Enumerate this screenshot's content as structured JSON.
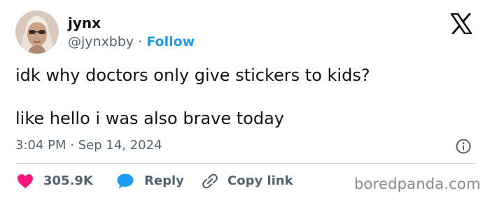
{
  "user": {
    "display_name": "jynx",
    "handle": "@jynxbby",
    "separator": "·",
    "follow_label": "Follow"
  },
  "tweet": {
    "line1": "idk why doctors only give stickers to kids?",
    "line2": "like hello i was also brave today"
  },
  "meta": {
    "time": "3:04 PM",
    "separator": "·",
    "date": "Sep 14, 2024"
  },
  "actions": {
    "like_count": "305.9K",
    "reply_label": "Reply",
    "copy_label": "Copy link"
  },
  "watermark": "boredpanda.com",
  "icons": {
    "brand": "x-logo-icon",
    "info": "info-icon",
    "like": "heart-icon",
    "reply": "speech-bubble-icon",
    "copy": "link-icon"
  },
  "colors": {
    "text": "#0f1419",
    "muted": "#536471",
    "follow": "#1d9bf0",
    "heart": "#f91880",
    "reply_bubble": "#1d9bf0",
    "divider": "#cfd9de",
    "watermark": "#8a8a8a"
  }
}
